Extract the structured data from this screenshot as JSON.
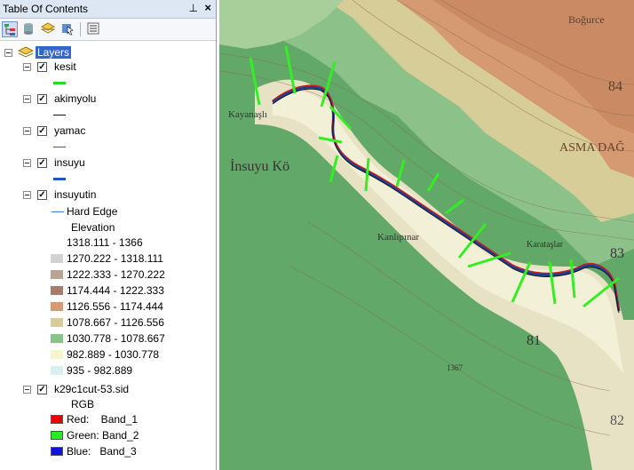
{
  "panel": {
    "title": "Table Of Contents",
    "pin_glyph": "ᵖ",
    "close_glyph": "x"
  },
  "toolbar": {
    "buttons": [
      "list-by-drawing-order-icon",
      "list-by-source-icon",
      "list-by-visibility-icon",
      "list-by-selection-icon",
      "options-icon"
    ]
  },
  "tree": {
    "root": "Layers",
    "layers": [
      {
        "name": "kesit",
        "symbol_color": "#22dd22"
      },
      {
        "name": "akimyolu",
        "symbol_color": "#111111"
      },
      {
        "name": "yamac",
        "symbol_color": "#dd2222"
      },
      {
        "name": "insuyu",
        "symbol_color": "#2255cc"
      },
      {
        "name": "insuyutin",
        "symbol_color": "#3a7fd0"
      }
    ],
    "tin": {
      "hard_edge": "Hard Edge",
      "elevation": "Elevation",
      "classes": [
        {
          "label": "1318.111 - 1366",
          "color": "#ffffff"
        },
        {
          "label": "1270.222 - 1318.111",
          "color": "#d2d2d2"
        },
        {
          "label": "1222.333 - 1270.222",
          "color": "#b7a495"
        },
        {
          "label": "1174.444 - 1222.333",
          "color": "#a67d6a"
        },
        {
          "label": "1126.556 - 1174.444",
          "color": "#d69a72"
        },
        {
          "label": "1078.667 - 1126.556",
          "color": "#d8cc9a"
        },
        {
          "label": "1030.778 - 1078.667",
          "color": "#88c488"
        },
        {
          "label": "982.889 - 1030.778",
          "color": "#f6f6cc"
        },
        {
          "label": "935 - 982.889",
          "color": "#d8f0f0"
        }
      ]
    },
    "raster": {
      "name": "k29c1cut-53.sid",
      "rgb": "RGB",
      "bands": [
        {
          "label": "Red:    Band_1",
          "color": "#ee0000"
        },
        {
          "label": "Green: Band_2",
          "color": "#22ee22"
        },
        {
          "label": "Blue:   Band_3",
          "color": "#1111dd"
        }
      ]
    }
  },
  "map": {
    "labels": [
      "Boğurce",
      "84",
      "ASMA DAĞ",
      "Kayanaşlı",
      "İnsuyu Kö",
      "Kanlıpınar",
      "Karataşlar",
      "83",
      "81",
      "1367",
      "82"
    ]
  }
}
